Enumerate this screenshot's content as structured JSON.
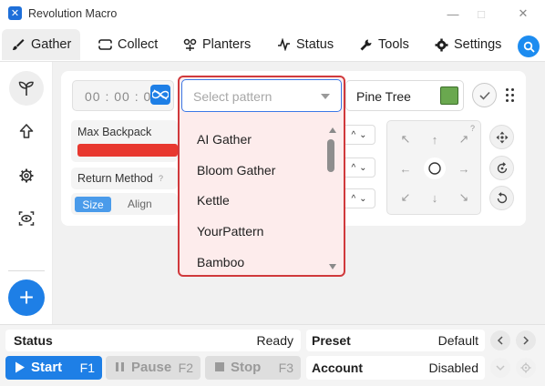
{
  "window": {
    "title": "Revolution Macro",
    "logo_glyph": "✕",
    "minimize": "—",
    "maximize": "□",
    "close": "✕"
  },
  "tabs": [
    {
      "label": "Gather",
      "icon": "brush-icon",
      "active": true
    },
    {
      "label": "Collect",
      "icon": "ticket-icon"
    },
    {
      "label": "Planters",
      "icon": "planter-icon"
    },
    {
      "label": "Status",
      "icon": "pulse-icon"
    },
    {
      "label": "Tools",
      "icon": "wrench-icon"
    },
    {
      "label": "Settings",
      "icon": "gear-icon"
    }
  ],
  "sidebar": {
    "items": [
      "sprout-icon",
      "arrow-up-icon",
      "gear-icon",
      "eye-scan-icon"
    ],
    "add": "+"
  },
  "gather": {
    "timer": "00 : 00 : 00",
    "pattern_placeholder": "Select pattern",
    "field": "Pine Tree",
    "max_backpack_label": "Max Backpack",
    "backpack_fill": 1.0,
    "return_method_label": "Return Method",
    "help_mark": "?",
    "return_options": [
      "Size",
      "Align"
    ],
    "return_selected": "Size",
    "pattern_options": [
      "AI Gather",
      "Bloom Gather",
      "Kettle",
      "YourPattern",
      "Bamboo"
    ]
  },
  "bottom": {
    "status_label": "Status",
    "status_value": "Ready",
    "preset_label": "Preset",
    "preset_value": "Default",
    "account_label": "Account",
    "account_value": "Disabled",
    "start": {
      "label": "Start",
      "key": "F1"
    },
    "pause": {
      "label": "Pause",
      "key": "F2"
    },
    "stop": {
      "label": "Stop",
      "key": "F3"
    }
  },
  "colors": {
    "accent": "#1e7fe6",
    "backpack_bar": "#e8382f",
    "dropdown_border": "#d0393c"
  }
}
